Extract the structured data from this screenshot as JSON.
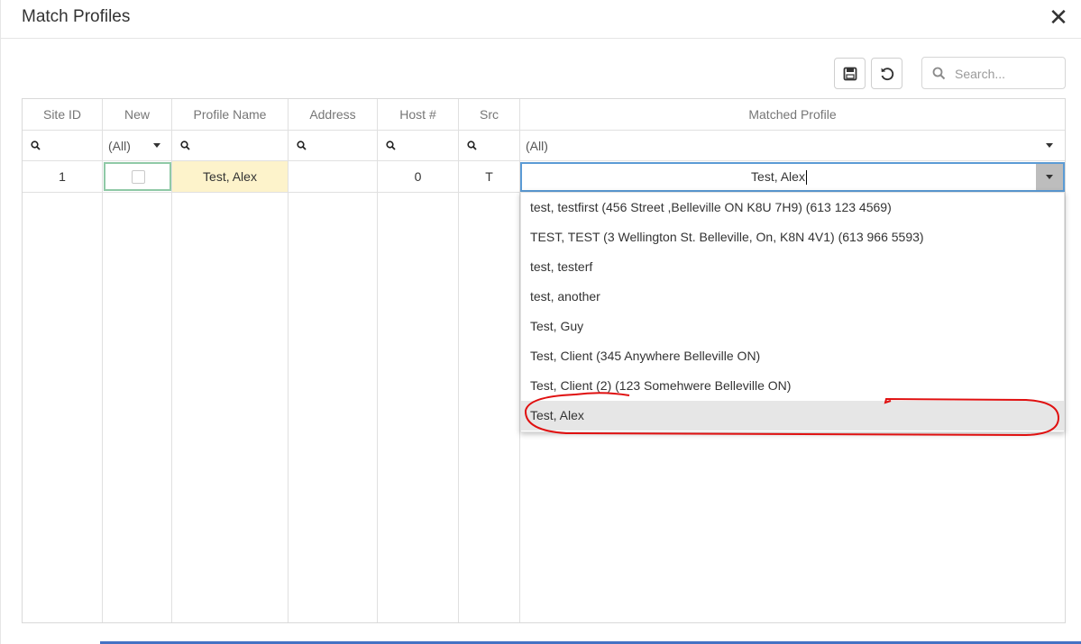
{
  "dialog": {
    "title": "Match Profiles",
    "close_symbol": "✕"
  },
  "toolbar": {
    "save_icon": "save-icon",
    "undo_icon": "undo-icon",
    "search_placeholder": "Search..."
  },
  "grid": {
    "columns": [
      "Site ID",
      "New",
      "Profile Name",
      "Address",
      "Host #",
      "Src",
      "Matched Profile"
    ],
    "filters": {
      "new": "(All)",
      "matched_profile": "(All)"
    },
    "row": {
      "site_id": "1",
      "new_checked": false,
      "profile_name": "Test, Alex",
      "address": "",
      "host": "0",
      "src": "T",
      "matched_profile": "Test, Alex"
    }
  },
  "dropdown": {
    "items": [
      "test, testfirst (456 Street ,Belleville ON K8U 7H9) (613 123 4569)",
      "TEST, TEST (3 Wellington St. Belleville, On, K8N 4V1) (613 966 5593)",
      "test, testerf",
      "test, another",
      "Test, Guy",
      "Test, Client (345 Anywhere Belleville ON)",
      "Test, Client (2) (123 Somehwere Belleville ON)",
      "Test, Alex"
    ],
    "selected_index": 7
  },
  "colors": {
    "highlight_cell": "#fdf3cb",
    "focus_border": "#5b9bd5",
    "annotation": "#e01010"
  }
}
